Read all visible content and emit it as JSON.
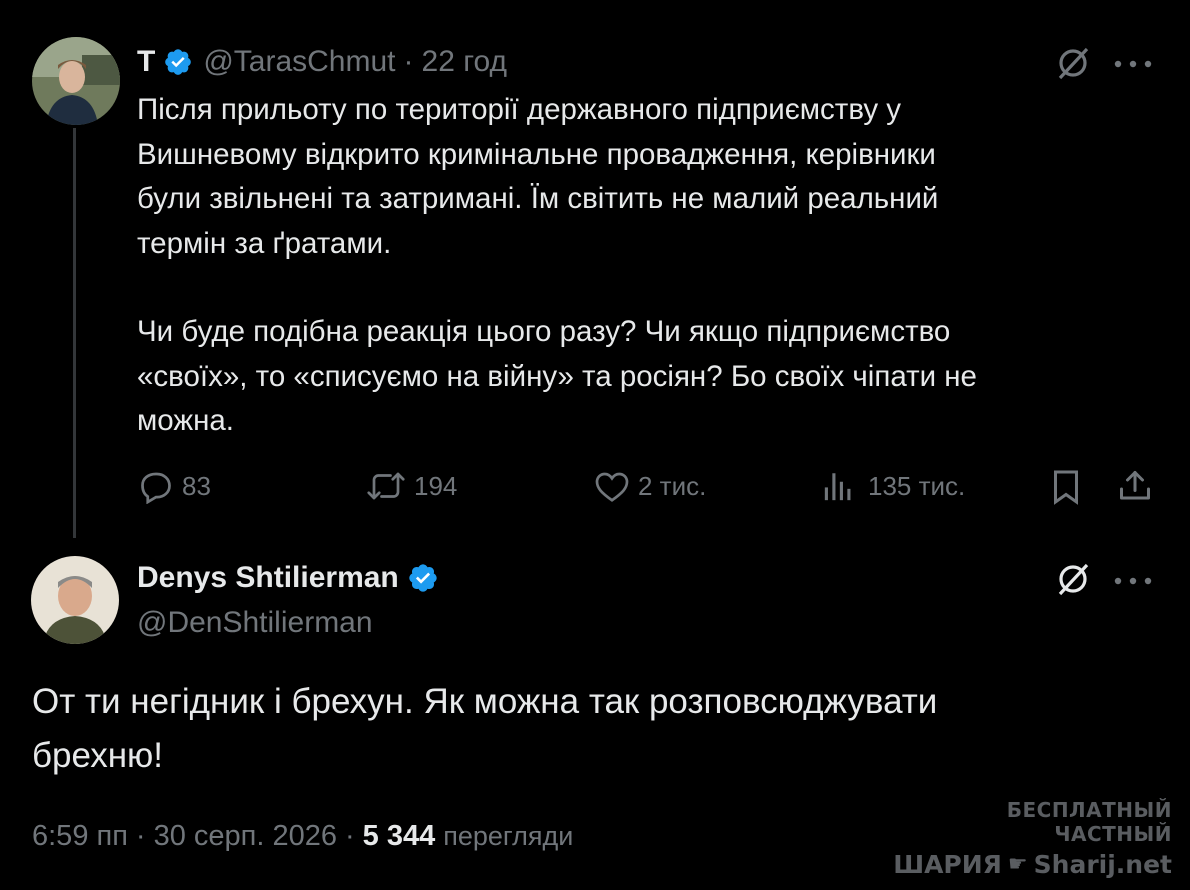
{
  "tweet": {
    "display_name": "Т",
    "handle": "@TarasChmut",
    "separator": "·",
    "time": "22 год",
    "paragraph1_lines": [
      "Після прильоту по території державного підприємству у",
      "Вишневому відкрито кримінальне провадження, керівники",
      "були звільнені та затримані. Їм світить не малий реальний",
      "термін за ґратами."
    ],
    "paragraph2_lines": [
      "Чи буде подібна реакція цього разу? Чи якщо підприємство",
      "«своїх», то «списуємо на війну» та росіян? Бо своїх чіпати не",
      "можна."
    ],
    "actions": {
      "replies": "83",
      "reposts": "194",
      "likes": "2 тис.",
      "views": "135 тис."
    }
  },
  "reply": {
    "display_name": "Denys Shtilierman",
    "handle": "@DenShtilierman",
    "text_lines": [
      "От ти негідник і брехун. Як можна так розповсюджувати",
      "брехню!"
    ],
    "meta": {
      "time": "6:59 пп",
      "separator1": "·",
      "date": "30 серп. 2026",
      "separator2": "·",
      "views_count": "5 344",
      "views_label": "перегляди"
    }
  },
  "watermark": {
    "line1": "БЕСПЛАТНЫЙ ЧАСТНЫЙ",
    "line2_left": "ШАРИЯ",
    "line2_right": "Sharij.net"
  },
  "colors": {
    "background": "#000000",
    "text": "#e7e9ea",
    "muted": "#71767b",
    "verified": "#1d9bf0"
  }
}
